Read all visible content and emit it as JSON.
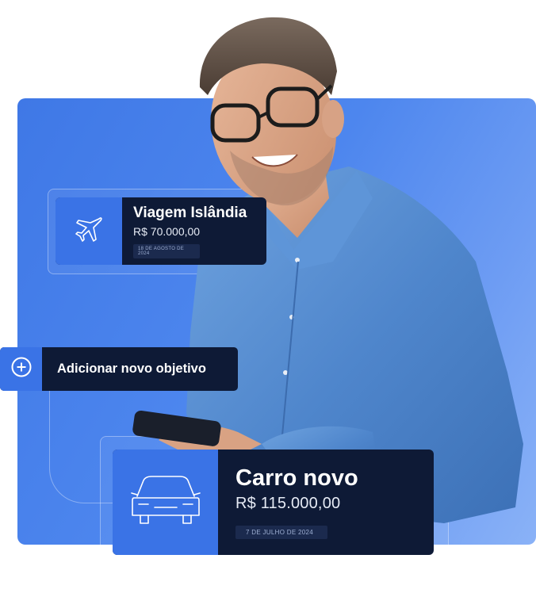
{
  "colors": {
    "card_bg": "#0e1a36",
    "icon_bg": "#3a73e6",
    "panel_start": "#3f78e6",
    "panel_end": "#8ab2f7",
    "chip_bg": "#1b2a4e"
  },
  "goals": [
    {
      "icon": "airplane-icon",
      "title": "Viagem Islândia",
      "amount": "R$ 70.000,00",
      "date": "18 DE AGOSTO DE 2024"
    },
    {
      "icon": "car-icon",
      "title": "Carro novo",
      "amount": "R$ 115.000,00",
      "date": "7 DE JULHO DE 2024"
    }
  ],
  "add_goal": {
    "icon": "plus-circle-icon",
    "label": "Adicionar novo objetivo"
  }
}
